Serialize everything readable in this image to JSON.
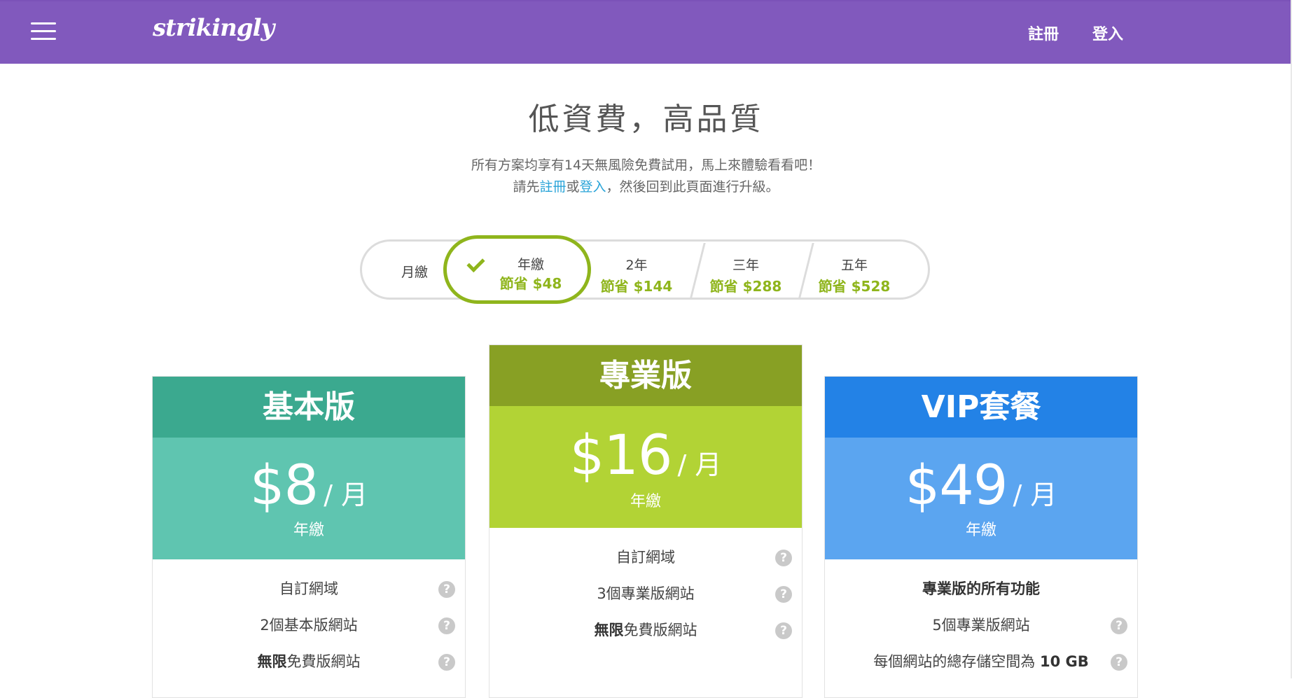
{
  "header": {
    "logo": "strikingly",
    "signup": "註冊",
    "login": "登入",
    "bar_color": "#8159bd"
  },
  "hero": {
    "title": "低資費，高品質",
    "line1": "所有方案均享有14天無風險免費試用，馬上來體驗看看吧！",
    "line2_pre": "請先",
    "line2_signup": "註冊",
    "line2_or": "或",
    "line2_login": "登入",
    "line2_post": "，然後回到此頁面進行升級。"
  },
  "billing": {
    "monthly": "月繳",
    "annual": {
      "name": "年繳",
      "save": "節省 $48",
      "selected": true
    },
    "two_year": {
      "name": "2年",
      "save": "節省 $144"
    },
    "three_year": {
      "name": "三年",
      "save": "節省 $288"
    },
    "five_year": {
      "name": "五年",
      "save": "節省 $528"
    },
    "accent_color": "#8fb51c"
  },
  "plans": {
    "basic": {
      "name": "基本版",
      "price": "$8",
      "unit": "/ 月",
      "period": "年繳",
      "features": [
        {
          "bold": "",
          "text": "自訂網域"
        },
        {
          "bold": "",
          "text": "2個基本版網站"
        },
        {
          "bold": "無限",
          "text": "免費版網站"
        }
      ],
      "header_color": "#3ba98f",
      "price_color": "#5fc5b0"
    },
    "pro": {
      "name": "專業版",
      "price": "$16",
      "unit": "/ 月",
      "period": "年繳",
      "features": [
        {
          "bold": "",
          "text": "自訂網域"
        },
        {
          "bold": "",
          "text": "3個專業版網站"
        },
        {
          "bold": "無限",
          "text": "免費版網站"
        }
      ],
      "header_color": "#88a024",
      "price_color": "#b2d335"
    },
    "vip": {
      "name": "VIP套餐",
      "price": "$49",
      "unit": "/ 月",
      "period": "年繳",
      "features": [
        {
          "bold": "",
          "text": "專業版的所有功能"
        },
        {
          "bold": "",
          "text": "5個專業版網站"
        },
        {
          "bold_end": "10 GB",
          "text": "每個網站的總存儲空間為"
        }
      ],
      "header_color": "#2382e6",
      "price_color": "#5ba5f0"
    }
  },
  "help_icon": "?"
}
